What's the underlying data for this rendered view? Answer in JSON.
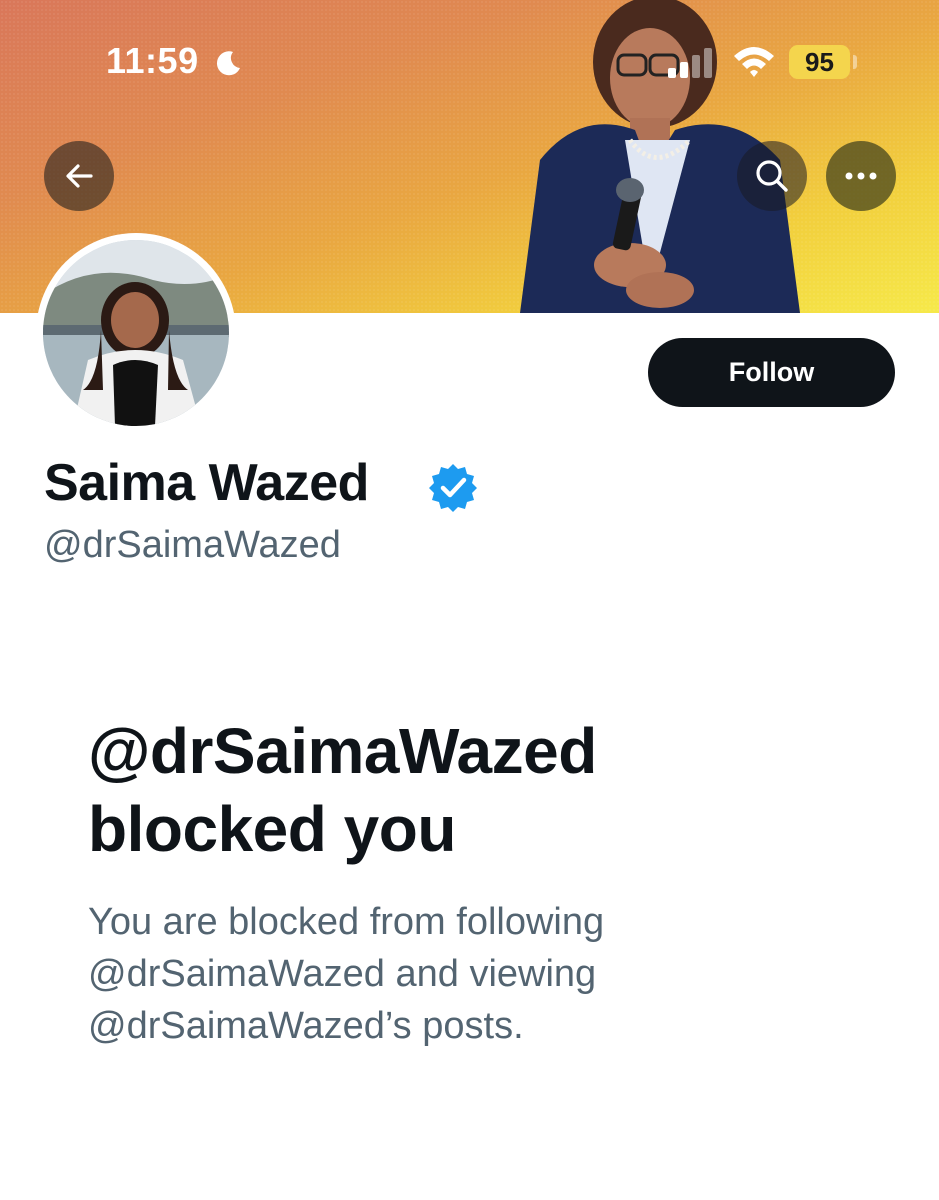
{
  "status_bar": {
    "time": "11:59",
    "battery": "95",
    "icons": [
      "moon-icon",
      "signal-icon",
      "wifi-icon",
      "battery-icon"
    ]
  },
  "header": {
    "icons": [
      "back-arrow-icon",
      "search-icon",
      "more-icon"
    ]
  },
  "profile": {
    "display_name": "Saima Wazed",
    "handle": "@drSaimaWazed",
    "follow_label": "Follow",
    "verified_icon": "verified-badge-icon"
  },
  "blocked": {
    "title_line1": "@drSaimaWazed",
    "title_line2": "blocked you",
    "desc_line1": "You are blocked from following",
    "desc_line2": "@drSaimaWazed and viewing",
    "desc_line3": "@drSaimaWazed’s posts."
  },
  "colors": {
    "primary_text": "#0f1419",
    "secondary_text": "#536471",
    "verified_blue": "#1d9bf0",
    "battery_yellow": "#f4d54d"
  }
}
